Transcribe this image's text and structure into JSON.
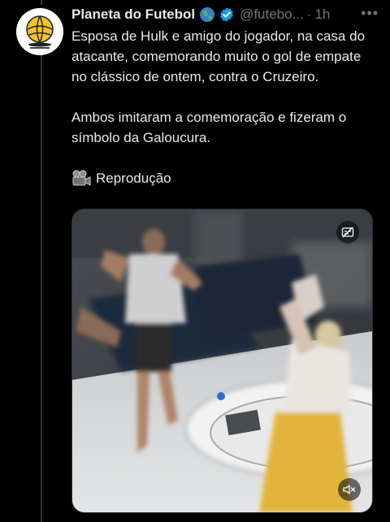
{
  "tweet": {
    "display_name": "Planeta do Futebol",
    "globe_icon": "globe-icon",
    "verified_icon": "verified-badge-icon",
    "handle": "@futebo...",
    "separator": "·",
    "time": "1h",
    "more_icon": "more-icon",
    "text_p1": "Esposa de Hulk e amigo do jogador, na casa do atacante, comemorando muito o gol de empate no clássico de ontem, contra o Cruzeiro.",
    "text_p2": "Ambos imitaram a comemoração e fizeram o símbolo da Galoucura.",
    "credit_icon": "film-camera-icon",
    "credit": "Reprodução"
  },
  "media": {
    "type": "video",
    "captions_icon": "captions-off-icon",
    "mute_icon": "volume-muted-icon"
  },
  "colors": {
    "background": "#000000",
    "text": "#e7e9ea",
    "secondary": "#71767b",
    "verified": "#1d9bf0",
    "border": "#2f3336"
  }
}
